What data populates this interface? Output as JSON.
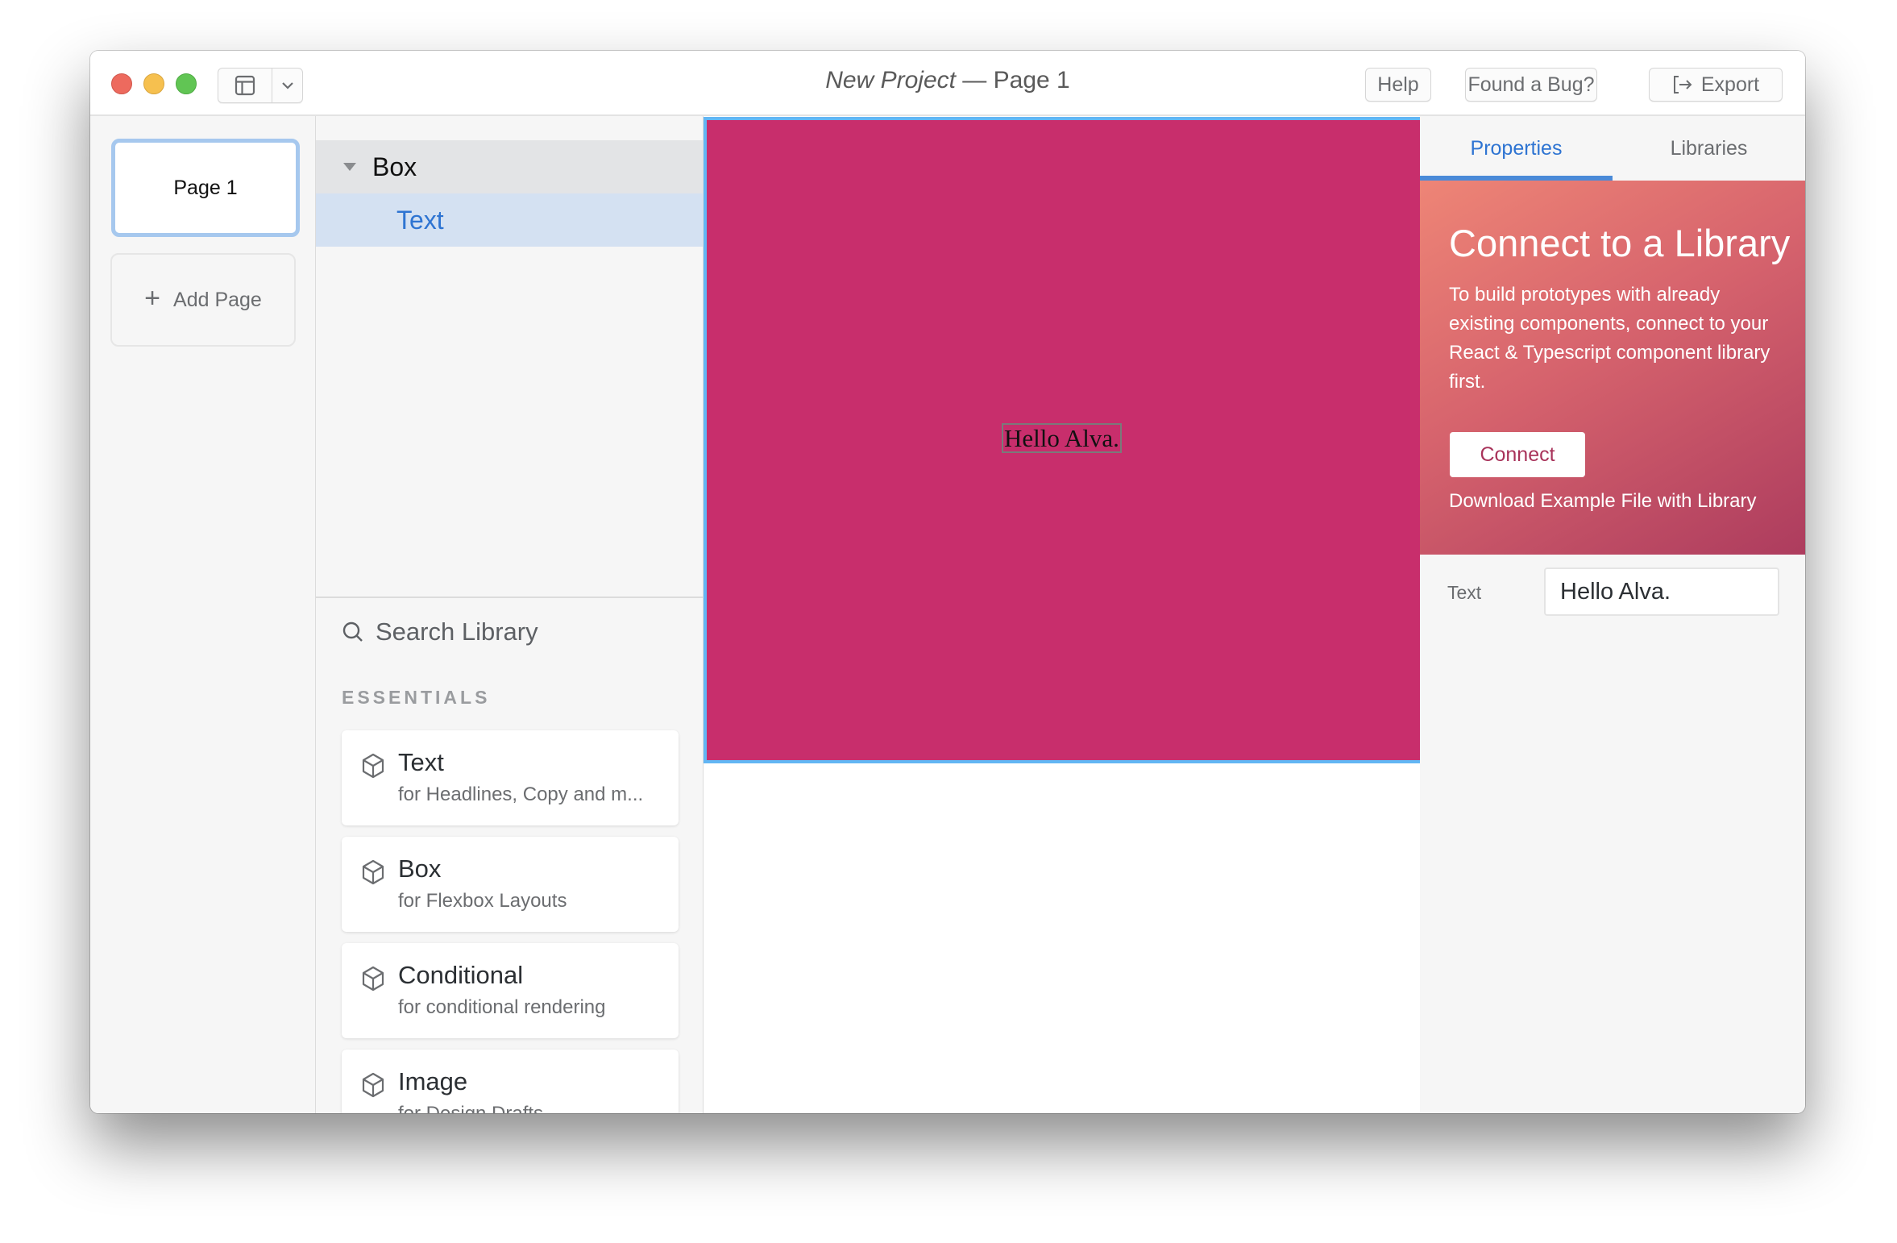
{
  "window": {
    "title_project": "New Project",
    "title_separator": " — ",
    "title_page": "Page 1"
  },
  "toolbar": {
    "layout_icon": "layout-panels-icon",
    "dropdown_icon": "chevron-down-icon",
    "help_label": "Help",
    "bug_label": "Found a Bug?",
    "export_label": "Export",
    "export_icon": "export-arrow-icon"
  },
  "pages": {
    "items": [
      {
        "label": "Page 1",
        "selected": true
      }
    ],
    "add_label": "Add Page"
  },
  "element_tree": {
    "items": [
      {
        "label": "Box",
        "expanded": true,
        "depth": 0
      },
      {
        "label": "Text",
        "selected": true,
        "depth": 1
      }
    ]
  },
  "library": {
    "search_placeholder": "Search Library",
    "section_title": "ESSENTIALS",
    "items": [
      {
        "name": "Text",
        "description": "for Headlines, Copy and m..."
      },
      {
        "name": "Box",
        "description": "for Flexbox Layouts"
      },
      {
        "name": "Conditional",
        "description": "for conditional rendering"
      },
      {
        "name": "Image",
        "description": "for Design Drafts"
      }
    ]
  },
  "canvas": {
    "artboard_color": "#c82e6c",
    "selection_color": "#62b6f4",
    "text_content": "Hello Alva."
  },
  "right_panel": {
    "tabs": [
      {
        "label": "Properties",
        "active": true
      },
      {
        "label": "Libraries",
        "active": false
      }
    ],
    "promo": {
      "heading": "Connect to a Library",
      "body": "To build prototypes with already existing components, connect to your React & Typescript component library first.",
      "connect_label": "Connect",
      "download_label": "Download Example File with Library"
    },
    "properties": [
      {
        "label": "Text",
        "value": "Hello Alva."
      }
    ]
  },
  "colors": {
    "accent": "#2e74d2",
    "tab_underline": "#4a8ad8",
    "promo_gradient_start": "#ee8576",
    "promo_gradient_end": "#ad3c5e"
  }
}
